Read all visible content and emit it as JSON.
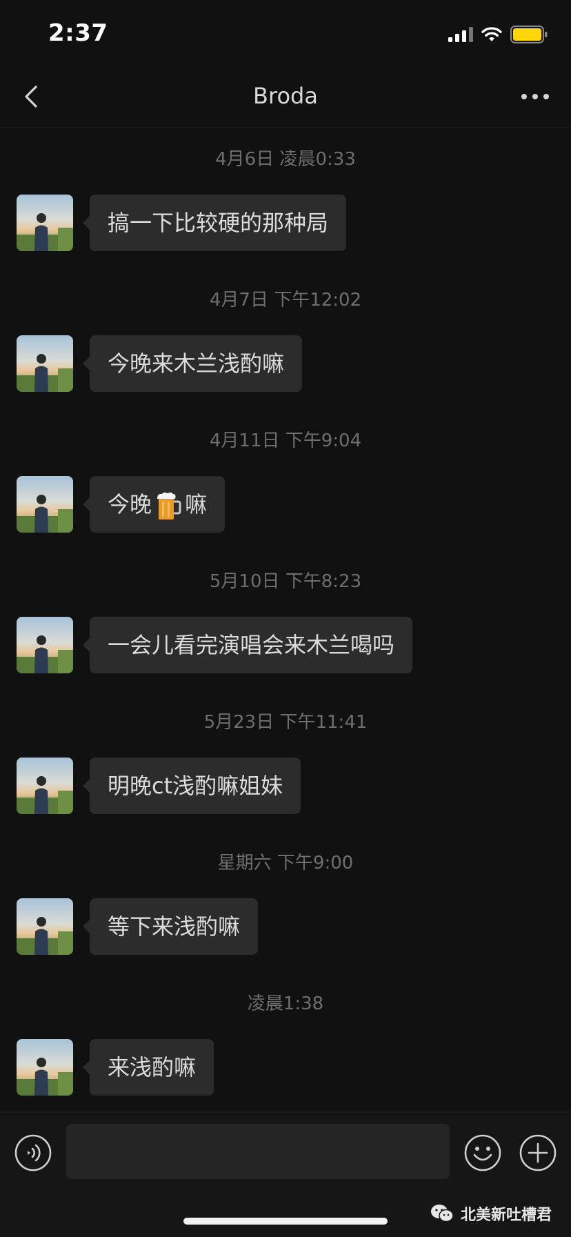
{
  "status_bar": {
    "time": "2:37",
    "battery_color": "#ffd60a",
    "icons": [
      "signal-icon",
      "wifi-icon",
      "battery-icon"
    ]
  },
  "header": {
    "title": "Broda",
    "back_icon": "chevron-left-icon",
    "more_icon": "more-dots-icon"
  },
  "messages": [
    {
      "timestamp": "4月6日 凌晨0:33",
      "text": "搞一下比较硬的那种局"
    },
    {
      "timestamp": "4月7日 下午12:02",
      "text": "今晚来木兰浅酌嘛"
    },
    {
      "timestamp": "4月11日 下午9:04",
      "text_before": "今晚",
      "emoji": "beer-mug-icon",
      "text_after": "嘛"
    },
    {
      "timestamp": "5月10日 下午8:23",
      "text": "一会儿看完演唱会来木兰喝吗"
    },
    {
      "timestamp": "5月23日 下午11:41",
      "text": "明晚ct浅酌嘛姐妹"
    },
    {
      "timestamp": "星期六 下午9:00",
      "text": "等下来浅酌嘛"
    },
    {
      "timestamp": "凌晨1:38",
      "text": "来浅酌嘛"
    }
  ],
  "input_bar": {
    "voice_icon": "voice-icon",
    "emoji_icon": "emoji-icon",
    "plus_icon": "plus-icon",
    "input_value": ""
  },
  "watermark": {
    "icon": "wechat-logo-icon",
    "text": "北美新吐槽君"
  },
  "colors": {
    "background": "#111111",
    "bubble": "#2c2c2c",
    "timestamp": "#6e6e6e",
    "text": "#dcdcdc"
  }
}
